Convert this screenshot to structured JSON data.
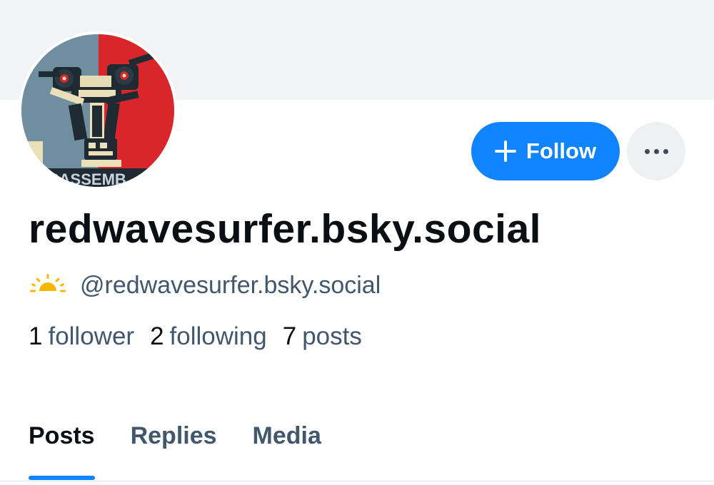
{
  "profile": {
    "display_name": "redwavesurfer.bsky.social",
    "handle": "@redwavesurfer.bsky.social",
    "avatar_text": "DISASSEMB"
  },
  "actions": {
    "follow_label": "Follow",
    "more_icon": "ellipsis-icon"
  },
  "stats": {
    "followers_count": "1",
    "followers_label": "follower",
    "following_count": "2",
    "following_label": "following",
    "posts_count": "7",
    "posts_label": "posts"
  },
  "tabs": [
    {
      "label": "Posts",
      "active": true
    },
    {
      "label": "Replies",
      "active": false
    },
    {
      "label": "Media",
      "active": false
    }
  ],
  "colors": {
    "accent": "#1083fe",
    "banner": "#f1f3f5",
    "text_primary": "#0b0f14",
    "text_secondary": "#42576c",
    "sun_icon": "#f5b800"
  }
}
